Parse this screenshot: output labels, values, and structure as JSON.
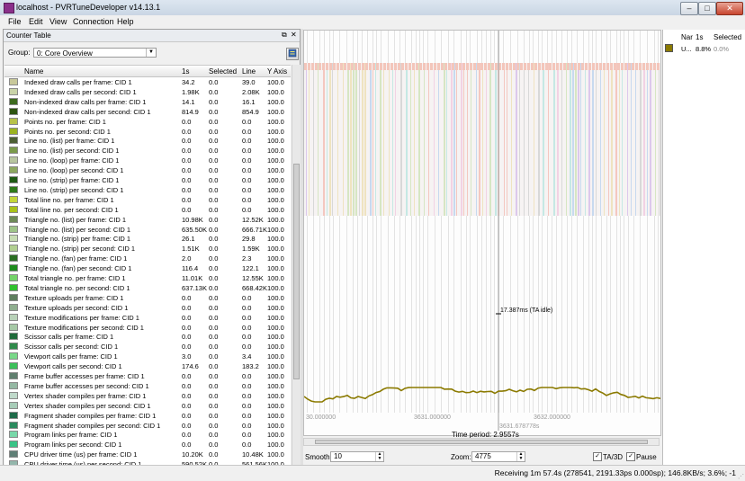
{
  "window": {
    "title": "localhost - PVRTuneDeveloper v14.13.1",
    "buttons": {
      "minimize": "–",
      "maximize": "□",
      "close": "✕"
    }
  },
  "menu": [
    "File",
    "Edit",
    "View",
    "Connection",
    "Help"
  ],
  "left_panel": {
    "title": "Counter Table",
    "float_icon": "⧉",
    "close_icon": "✕",
    "group_label": "Group:",
    "group_value": "0: Core Overview",
    "columns": [
      "Name",
      "1s",
      "Selected",
      "Line",
      "Y Axis"
    ],
    "rows": [
      {
        "color": "#c8c89a",
        "name": "Indexed draw calls per frame: CID 1",
        "s1": "34.2",
        "sel": "0.0",
        "line": "39.0",
        "y": "100.0"
      },
      {
        "color": "#c9d3a8",
        "name": "Indexed draw calls per second: CID 1",
        "s1": "1.98K",
        "sel": "0.0",
        "line": "2.08K",
        "y": "100.0"
      },
      {
        "color": "#3d6a1e",
        "name": "Non-indexed draw calls per frame: CID 1",
        "s1": "14.1",
        "sel": "0.0",
        "line": "16.1",
        "y": "100.0"
      },
      {
        "color": "#2e5410",
        "name": "Non-indexed draw calls per second: CID 1",
        "s1": "814.9",
        "sel": "0.0",
        "line": "854.9",
        "y": "100.0"
      },
      {
        "color": "#b7c24a",
        "name": "Points no. per frame: CID 1",
        "s1": "0.0",
        "sel": "0.0",
        "line": "0.0",
        "y": "100.0"
      },
      {
        "color": "#9bb320",
        "name": "Points no. per second: CID 1",
        "s1": "0.0",
        "sel": "0.0",
        "line": "0.0",
        "y": "100.0"
      },
      {
        "color": "#4c5f34",
        "name": "Line no. (list) per frame: CID 1",
        "s1": "0.0",
        "sel": "0.0",
        "line": "0.0",
        "y": "100.0"
      },
      {
        "color": "#7a9a4a",
        "name": "Line no. (list) per second: CID 1",
        "s1": "0.0",
        "sel": "0.0",
        "line": "0.0",
        "y": "100.0"
      },
      {
        "color": "#b8c6a0",
        "name": "Line no. (loop) per frame: CID 1",
        "s1": "0.0",
        "sel": "0.0",
        "line": "0.0",
        "y": "100.0"
      },
      {
        "color": "#8da860",
        "name": "Line no. (loop) per second: CID 1",
        "s1": "0.0",
        "sel": "0.0",
        "line": "0.0",
        "y": "100.0"
      },
      {
        "color": "#1f5a14",
        "name": "Line no. (strip) per frame: CID 1",
        "s1": "0.0",
        "sel": "0.0",
        "line": "0.0",
        "y": "100.0"
      },
      {
        "color": "#2f7a1a",
        "name": "Line no. (strip) per second: CID 1",
        "s1": "0.0",
        "sel": "0.0",
        "line": "0.0",
        "y": "100.0"
      },
      {
        "color": "#c4d63a",
        "name": "Total line no. per frame: CID 1",
        "s1": "0.0",
        "sel": "0.0",
        "line": "0.0",
        "y": "100.0"
      },
      {
        "color": "#a9c21a",
        "name": "Total line no. per second: CID 1",
        "s1": "0.0",
        "sel": "0.0",
        "line": "0.0",
        "y": "100.0"
      },
      {
        "color": "#6e8a58",
        "name": "Triangle no. (list) per frame: CID 1",
        "s1": "10.98K",
        "sel": "0.0",
        "line": "12.52K",
        "y": "100.0"
      },
      {
        "color": "#9ec488",
        "name": "Triangle no. (list) per second: CID 1",
        "s1": "635.50K",
        "sel": "0.0",
        "line": "666.71K",
        "y": "100.0"
      },
      {
        "color": "#c7dcb3",
        "name": "Triangle no. (strip) per frame: CID 1",
        "s1": "26.1",
        "sel": "0.0",
        "line": "29.8",
        "y": "100.0"
      },
      {
        "color": "#b1cf90",
        "name": "Triangle no. (strip) per second: CID 1",
        "s1": "1.51K",
        "sel": "0.0",
        "line": "1.59K",
        "y": "100.0"
      },
      {
        "color": "#2a6d22",
        "name": "Triangle no. (fan) per frame: CID 1",
        "s1": "2.0",
        "sel": "0.0",
        "line": "2.3",
        "y": "100.0"
      },
      {
        "color": "#1e8c1e",
        "name": "Triangle no. (fan) per second: CID 1",
        "s1": "116.4",
        "sel": "0.0",
        "line": "122.1",
        "y": "100.0"
      },
      {
        "color": "#74d36a",
        "name": "Total triangle no. per frame: CID 1",
        "s1": "11.01K",
        "sel": "0.0",
        "line": "12.55K",
        "y": "100.0"
      },
      {
        "color": "#31c12f",
        "name": "Total triangle no. per second: CID 1",
        "s1": "637.13K",
        "sel": "0.0",
        "line": "668.42K",
        "y": "100.0"
      },
      {
        "color": "#5e7e5e",
        "name": "Texture uploads per frame: CID 1",
        "s1": "0.0",
        "sel": "0.0",
        "line": "0.0",
        "y": "100.0"
      },
      {
        "color": "#8fae8f",
        "name": "Texture uploads per second: CID 1",
        "s1": "0.0",
        "sel": "0.0",
        "line": "0.0",
        "y": "100.0"
      },
      {
        "color": "#b8d1b8",
        "name": "Texture modifications per frame: CID 1",
        "s1": "0.0",
        "sel": "0.0",
        "line": "0.0",
        "y": "100.0"
      },
      {
        "color": "#a6c9a6",
        "name": "Texture modifications per second: CID 1",
        "s1": "0.0",
        "sel": "0.0",
        "line": "0.0",
        "y": "100.0"
      },
      {
        "color": "#1f6a3a",
        "name": "Scissor calls per frame: CID 1",
        "s1": "0.0",
        "sel": "0.0",
        "line": "0.0",
        "y": "100.0"
      },
      {
        "color": "#2f8a4a",
        "name": "Scissor calls per second: CID 1",
        "s1": "0.0",
        "sel": "0.0",
        "line": "0.0",
        "y": "100.0"
      },
      {
        "color": "#79d889",
        "name": "Viewport calls per frame: CID 1",
        "s1": "3.0",
        "sel": "0.0",
        "line": "3.4",
        "y": "100.0"
      },
      {
        "color": "#3cc05a",
        "name": "Viewport calls per second: CID 1",
        "s1": "174.6",
        "sel": "0.0",
        "line": "183.2",
        "y": "100.0"
      },
      {
        "color": "#5f7f6e",
        "name": "Frame buffer accesses per frame: CID 1",
        "s1": "0.0",
        "sel": "0.0",
        "line": "0.0",
        "y": "100.0"
      },
      {
        "color": "#94b8a3",
        "name": "Frame buffer accesses per second: CID 1",
        "s1": "0.0",
        "sel": "0.0",
        "line": "0.0",
        "y": "100.0"
      },
      {
        "color": "#bfd9ca",
        "name": "Vertex shader compiles per frame: CID 1",
        "s1": "0.0",
        "sel": "0.0",
        "line": "0.0",
        "y": "100.0"
      },
      {
        "color": "#a7ccb8",
        "name": "Vertex shader compiles per second: CID 1",
        "s1": "0.0",
        "sel": "0.0",
        "line": "0.0",
        "y": "100.0"
      },
      {
        "color": "#1e6b4a",
        "name": "Fragment shader compiles per frame: CID 1",
        "s1": "0.0",
        "sel": "0.0",
        "line": "0.0",
        "y": "100.0"
      },
      {
        "color": "#2b8a5e",
        "name": "Fragment shader compiles per second: CID 1",
        "s1": "0.0",
        "sel": "0.0",
        "line": "0.0",
        "y": "100.0"
      },
      {
        "color": "#78d8a9",
        "name": "Program links per frame: CID 1",
        "s1": "0.0",
        "sel": "0.0",
        "line": "0.0",
        "y": "100.0"
      },
      {
        "color": "#3ac487",
        "name": "Program links per second: CID 1",
        "s1": "0.0",
        "sel": "0.0",
        "line": "0.0",
        "y": "100.0"
      },
      {
        "color": "#5f7f76",
        "name": "CPU driver time (us) per frame: CID 1",
        "s1": "10.20K",
        "sel": "0.0",
        "line": "10.48K",
        "y": "100.0"
      },
      {
        "color": "#93b6ab",
        "name": "CPU driver time (us) per second: CID 1",
        "s1": "590.52K",
        "sel": "0.0",
        "line": "561.56K",
        "y": "100.0"
      }
    ]
  },
  "graph": {
    "annotation": "17.387ms (TA idle)",
    "axis_labels": [
      "30.000000",
      "3631.000000",
      "3632.000000",
      "3631.678778s"
    ],
    "time_period_label": "Time period: 2.9557s",
    "line_color": "#8b7a00",
    "smooth_label": "Smooth:",
    "smooth_value": "10",
    "zoom_label": "Zoom:",
    "zoom_value": "4775",
    "ta3d_label": "TA/3D",
    "pause_label": "Pause",
    "ta3d_checked": true,
    "pause_checked": true
  },
  "right_panel": {
    "columns": [
      "Nar",
      "1s",
      "Selected"
    ],
    "row": {
      "color": "#8b7a00",
      "name": "U...",
      "s1": "8.8%",
      "sel": "0.0%"
    }
  },
  "status": "Receiving 1m 57.4s (278541, 2191.33ps 0.000sp); 146.8KB/s; 3.6%; -1"
}
